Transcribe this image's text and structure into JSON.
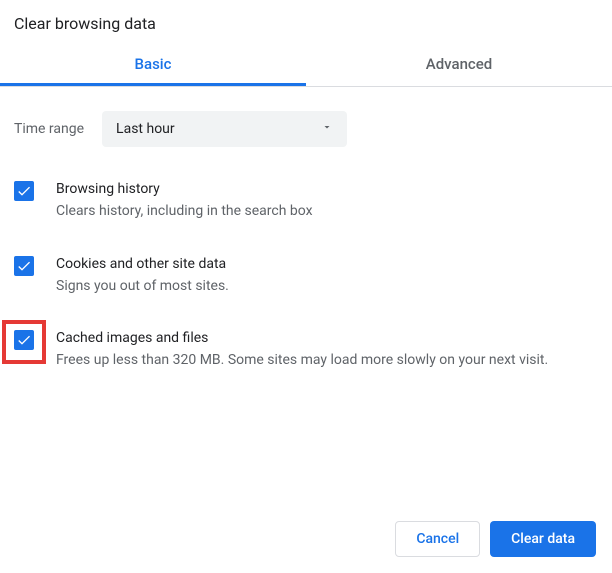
{
  "dialog": {
    "title": "Clear browsing data"
  },
  "tabs": {
    "basic": "Basic",
    "advanced": "Advanced"
  },
  "time_range": {
    "label": "Time range",
    "value": "Last hour"
  },
  "options": {
    "browsing_history": {
      "title": "Browsing history",
      "desc": "Clears history, including in the search box"
    },
    "cookies": {
      "title": "Cookies and other site data",
      "desc": "Signs you out of most sites."
    },
    "cache": {
      "title": "Cached images and files",
      "desc": "Frees up less than 320 MB. Some sites may load more slowly on your next visit."
    }
  },
  "actions": {
    "cancel": "Cancel",
    "clear": "Clear data"
  }
}
